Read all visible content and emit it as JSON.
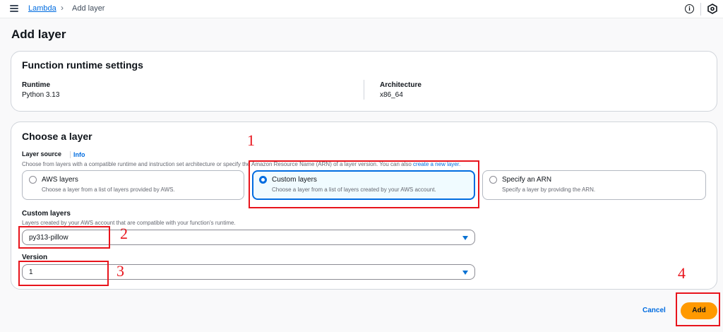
{
  "breadcrumb": {
    "link": "Lambda",
    "separator": "›",
    "current": "Add layer"
  },
  "page": {
    "title": "Add layer"
  },
  "runtime_settings": {
    "title": "Function runtime settings",
    "runtime_label": "Runtime",
    "runtime_value": "Python 3.13",
    "arch_label": "Architecture",
    "arch_value": "x86_64"
  },
  "choose_layer": {
    "title": "Choose a layer",
    "source_label": "Layer source",
    "info_link": "Info",
    "source_hint": "Choose from layers with a compatible runtime and instruction set architecture or specify the Amazon Resource Name (ARN) of a layer version. You can also ",
    "source_hint_link": "create a new layer.",
    "options": [
      {
        "title": "AWS layers",
        "desc": "Choose a layer from a list of layers provided by AWS.",
        "selected": false
      },
      {
        "title": "Custom layers",
        "desc": "Choose a layer from a list of layers created by your AWS account.",
        "selected": true
      },
      {
        "title": "Specify an ARN",
        "desc": "Specify a layer by providing the ARN.",
        "selected": false
      }
    ],
    "custom_label": "Custom layers",
    "custom_hint": "Layers created by your AWS account that are compatible with your function's runtime.",
    "custom_value": "py313-pillow",
    "version_label": "Version",
    "version_value": "1"
  },
  "actions": {
    "cancel": "Cancel",
    "add": "Add"
  },
  "annotations": [
    "1",
    "2",
    "3",
    "4"
  ],
  "colors": {
    "accent": "#006ce0",
    "primary_button": "#ff9900",
    "annotation": "#e8141c"
  }
}
